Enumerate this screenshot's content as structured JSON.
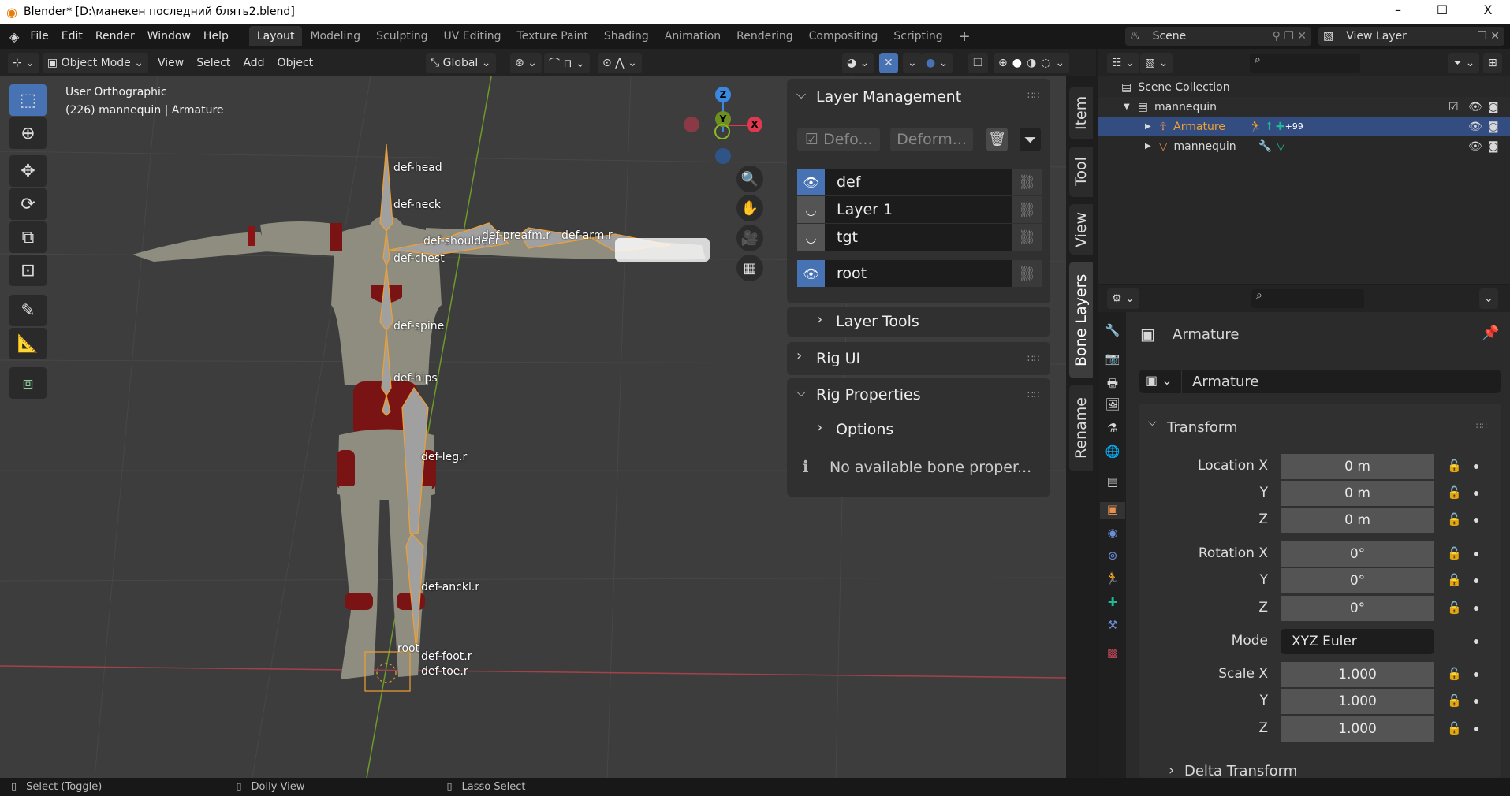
{
  "window": {
    "title": "Blender* [D:\\манекен последний блять2.blend]",
    "minimize": "–",
    "maximize": "☐",
    "close": "X"
  },
  "menu": {
    "items": [
      "File",
      "Edit",
      "Render",
      "Window",
      "Help"
    ],
    "workspaces": [
      "Layout",
      "Modeling",
      "Sculpting",
      "UV Editing",
      "Texture Paint",
      "Shading",
      "Animation",
      "Rendering",
      "Compositing",
      "Scripting"
    ],
    "active_workspace": "Layout",
    "add_tab": "+",
    "scene": "Scene",
    "view_layer": "View Layer"
  },
  "viewport_header": {
    "mode": "Object Mode",
    "menus": [
      "View",
      "Select",
      "Add",
      "Object"
    ],
    "orientation": "Global"
  },
  "viewport": {
    "view_name": "User Orthographic",
    "object_info": "(226) mannequin | Armature",
    "bones": [
      "def-head",
      "def-neck",
      "def-shoulder.r",
      "def-chest",
      "def-preafm.r",
      "def-arm.r",
      "def-spine",
      "def-hips",
      "def-leg.r",
      "def-anckl.r",
      "root",
      "def-foot.r",
      "def-toe.r"
    ],
    "gizmo": {
      "x": "X",
      "y": "Y",
      "z": "Z"
    },
    "axis_colors": {
      "x": "#e0384f",
      "y": "#8bbb1e",
      "z": "#3a88e0"
    }
  },
  "n_panel": {
    "layer_management": {
      "title": "Layer Management",
      "btn1": "Defo...",
      "btn2": "Deform...",
      "layers": [
        {
          "name": "def",
          "visible": true
        },
        {
          "name": "Layer 1",
          "visible": false
        },
        {
          "name": "tgt",
          "visible": false
        }
      ],
      "root_layer": {
        "name": "root",
        "visible": true
      }
    },
    "layer_tools": "Layer Tools",
    "rig_ui": "Rig UI",
    "rig_properties": "Rig Properties",
    "options": "Options",
    "info": "No available bone proper...",
    "tabs": [
      "Item",
      "Tool",
      "View",
      "Bone Layers",
      "Rename"
    ],
    "active_tab": "Bone Layers"
  },
  "outliner": {
    "scene_collection": "Scene Collection",
    "rows": [
      {
        "name": "mannequin",
        "type": "collection"
      },
      {
        "name": "Armature",
        "type": "armature",
        "selected": true,
        "badge": "+99"
      },
      {
        "name": "mannequin",
        "type": "mesh"
      }
    ]
  },
  "properties": {
    "object_name": "Armature",
    "name_field": "Armature",
    "transform_title": "Transform",
    "rows": [
      {
        "label": "Location X",
        "value": "0 m"
      },
      {
        "label": "Y",
        "value": "0 m"
      },
      {
        "label": "Z",
        "value": "0 m"
      },
      {
        "label": "Rotation X",
        "value": "0°"
      },
      {
        "label": "Y",
        "value": "0°"
      },
      {
        "label": "Z",
        "value": "0°"
      },
      {
        "label": "Mode",
        "value": "XYZ Euler"
      },
      {
        "label": "Scale X",
        "value": "1.000"
      },
      {
        "label": "Y",
        "value": "1.000"
      },
      {
        "label": "Z",
        "value": "1.000"
      }
    ],
    "delta_transform": "Delta Transform"
  },
  "status": {
    "left": "Select (Toggle)",
    "middle": "Dolly View",
    "right": "Lasso Select"
  },
  "colors": {
    "accent": "#4772b3",
    "selected_row": "#334d80",
    "bone": "#f0a030",
    "armature_text": "#f0a030"
  }
}
